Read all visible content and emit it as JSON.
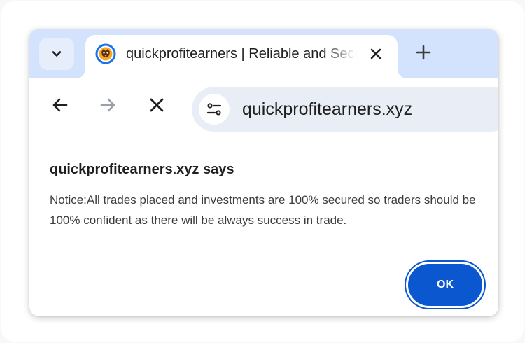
{
  "tab": {
    "title": "quickprofitearners | Reliable and Secure",
    "favicon": "site-favicon-icon"
  },
  "tabstrip": {
    "search_icon": "chevron-down-icon",
    "close_icon": "close-icon",
    "new_tab_icon": "plus-icon"
  },
  "toolbar": {
    "back_icon": "arrow-left-icon",
    "forward_icon": "arrow-right-icon",
    "stop_icon": "close-icon",
    "site_info_icon": "tune-icon",
    "url": "quickprofitearners.xyz"
  },
  "dialog": {
    "title": "quickprofitearners.xyz says",
    "message": "Notice:All trades placed and investments are 100% secured so traders should be 100% confident as there will be always success in trade.",
    "ok_label": "OK"
  },
  "colors": {
    "tabstrip_bg": "#d3e3fd",
    "omnibox_bg": "#e9eef6",
    "accent": "#0b57d0",
    "text": "#1f1f1f"
  }
}
